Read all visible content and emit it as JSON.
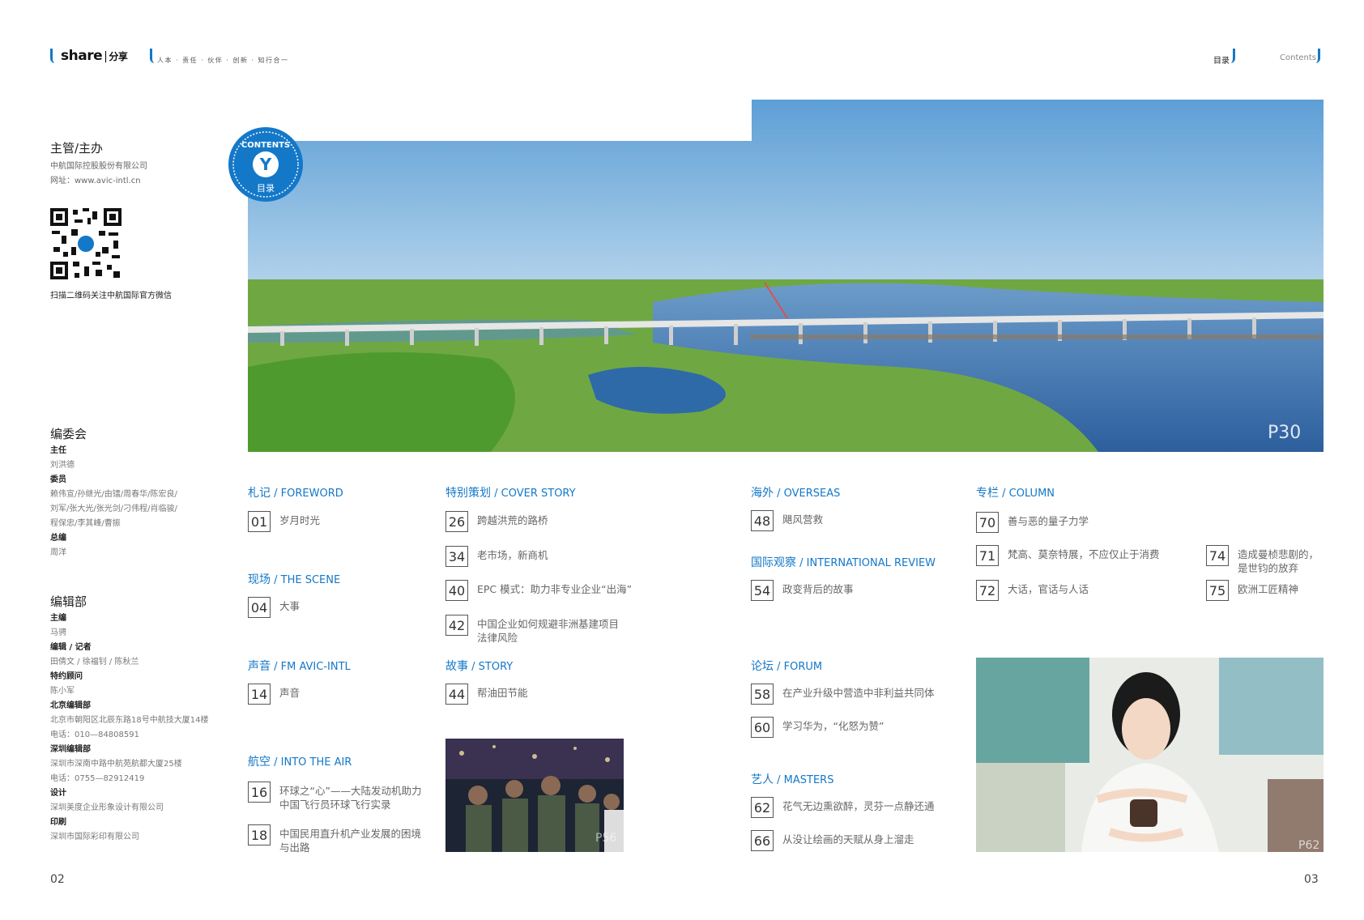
{
  "header": {
    "logo_main": "share",
    "logo_cn": "分享",
    "tagline": "人本 · 责任 · 伙伴 · 创新 · 知行合一",
    "right_cn": "目录",
    "right_en": "Contents"
  },
  "sidebar": {
    "publisher_heading": "主管/主办",
    "publisher_name": "中航国际控股股份有限公司",
    "website": "网址：www.avic-intl.cn",
    "qr_caption": "扫描二维码关注中航国际官方微信",
    "committee_heading": "编委会",
    "committee": [
      {
        "role": "主任",
        "names": [
          "刘洪德"
        ]
      },
      {
        "role": "委员",
        "names": [
          "赖伟宣/孙继光/由镭/周春华/陈宏良/",
          "刘军/张大光/张光剑/刁伟程/肖临骏/",
          "程保忠/李其峰/曹振"
        ]
      },
      {
        "role": "总编",
        "names": [
          "周洋"
        ]
      }
    ],
    "editorial_heading": "编辑部",
    "editorial": [
      {
        "role": "主编",
        "names": [
          "马骋"
        ]
      },
      {
        "role": "编辑 / 记者",
        "names": [
          "田倩文 / 徐福钊 / 陈秋兰"
        ]
      },
      {
        "role": "特约顾问",
        "names": [
          "陈小军"
        ]
      },
      {
        "role": "北京编辑部",
        "names": [
          "北京市朝阳区北辰东路18号中航技大厦14楼",
          "电话：010—84808591"
        ]
      },
      {
        "role": "深圳编辑部",
        "names": [
          "深圳市深南中路中航苑航都大厦25楼",
          "电话：0755—82912419"
        ]
      },
      {
        "role": "设计",
        "names": [
          "深圳美度企业形象设计有限公司"
        ]
      },
      {
        "role": "印刷",
        "names": [
          "深圳市国际彩印有限公司"
        ]
      }
    ]
  },
  "badge": {
    "text_en": "CONTENTS",
    "text_cn": "目录",
    "letter": "Y"
  },
  "hero": {
    "label": "P30"
  },
  "photo_small": {
    "label": "P56"
  },
  "photo_right": {
    "label": "P62"
  },
  "sections": {
    "foreword": {
      "cn": "札记",
      "en": " / FOREWORD",
      "items": [
        {
          "num": "01",
          "text": "岁月时光"
        }
      ]
    },
    "scene": {
      "cn": "现场",
      "en": " / THE SCENE",
      "items": [
        {
          "num": "04",
          "text": "大事"
        }
      ]
    },
    "fm": {
      "cn": "声音",
      "en": " / FM AVIC-INTL",
      "items": [
        {
          "num": "14",
          "text": "声音"
        }
      ]
    },
    "air": {
      "cn": "航空",
      "en": " / INTO THE AIR",
      "items": [
        {
          "num": "16",
          "text": "环球之“心”——大陆发动机助力中国飞行员环球飞行实录"
        },
        {
          "num": "18",
          "text": "中国民用直升机产业发展的困境与出路"
        }
      ]
    },
    "cover": {
      "cn": "特别策划",
      "en": " / COVER STORY",
      "items": [
        {
          "num": "26",
          "text": "跨越洪荒的路桥"
        },
        {
          "num": "34",
          "text": "老市场，新商机"
        },
        {
          "num": "40",
          "text": "EPC 模式：助力非专业企业“出海”"
        },
        {
          "num": "42",
          "text": "中国企业如何规避非洲基建项目法律风险"
        }
      ]
    },
    "story": {
      "cn": "故事",
      "en": " / STORY",
      "items": [
        {
          "num": "44",
          "text": "帮油田节能"
        }
      ]
    },
    "overseas": {
      "cn": "海外",
      "en": " / OVERSEAS",
      "items": [
        {
          "num": "48",
          "text": "飓风营救"
        }
      ]
    },
    "review": {
      "cn": "国际观察",
      "en": " / INTERNATIONAL REVIEW",
      "items": [
        {
          "num": "54",
          "text": "政变背后的故事"
        }
      ]
    },
    "forum": {
      "cn": "论坛",
      "en": " / FORUM",
      "items": [
        {
          "num": "58",
          "text": "在产业升级中营造中非利益共同体"
        },
        {
          "num": "60",
          "text": "学习华为，“化怒为赞”"
        }
      ]
    },
    "masters": {
      "cn": "艺人",
      "en": " / MASTERS",
      "items": [
        {
          "num": "62",
          "text": "花气无边熏欲醉，灵芬一点静还通"
        },
        {
          "num": "66",
          "text": "从没让绘画的天赋从身上溜走"
        }
      ]
    },
    "column": {
      "cn": "专栏",
      "en": " / COLUMN",
      "items": [
        {
          "num": "70",
          "text": "善与恶的量子力学"
        },
        {
          "num": "71",
          "text": "梵高、莫奈特展，不应仅止于消费"
        },
        {
          "num": "72",
          "text": "大话，官话与人话"
        },
        {
          "num": "74",
          "text": "造成曼桢悲剧的，是世钧的放弃"
        },
        {
          "num": "75",
          "text": "欧洲工匠精神"
        }
      ]
    }
  },
  "pages": {
    "left": "02",
    "right": "03"
  },
  "colors": {
    "accent": "#1478c8"
  }
}
